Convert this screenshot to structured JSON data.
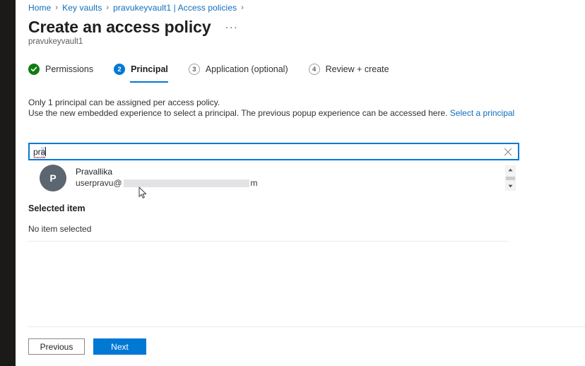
{
  "breadcrumb": {
    "items": [
      {
        "label": "Home"
      },
      {
        "label": "Key vaults"
      },
      {
        "label": "pravukeyvault1 | Access policies"
      }
    ],
    "separator": "›"
  },
  "header": {
    "title": "Create an access policy",
    "ellipsis": "···",
    "subtitle": "pravukeyvault1"
  },
  "steps": [
    {
      "badge": "✓",
      "label": "Permissions",
      "state": "done"
    },
    {
      "badge": "2",
      "label": "Principal",
      "state": "active"
    },
    {
      "badge": "3",
      "label": "Application (optional)",
      "state": "todo"
    },
    {
      "badge": "4",
      "label": "Review + create",
      "state": "todo"
    }
  ],
  "info": {
    "line1": "Only 1 principal can be assigned per access policy.",
    "line2": "Use the new embedded experience to select a principal. The previous popup experience can be accessed here.",
    "link": "Select a principal"
  },
  "search": {
    "value": "pra",
    "value_head": "pr",
    "value_selected": "a",
    "placeholder": "",
    "clear_icon": "close-icon"
  },
  "results": [
    {
      "initial": "P",
      "name": "Pravallika",
      "email_prefix": "userpravu@",
      "email_suffix": "m",
      "email_redacted": true
    }
  ],
  "selected": {
    "heading": "Selected item",
    "empty_text": "No item selected"
  },
  "footer": {
    "previous_label": "Previous",
    "next_label": "Next"
  },
  "colors": {
    "accent": "#0078d4",
    "link": "#0f6cbd",
    "success": "#107c10",
    "avatar": "#5c6670",
    "rail": "#1b1a19"
  }
}
